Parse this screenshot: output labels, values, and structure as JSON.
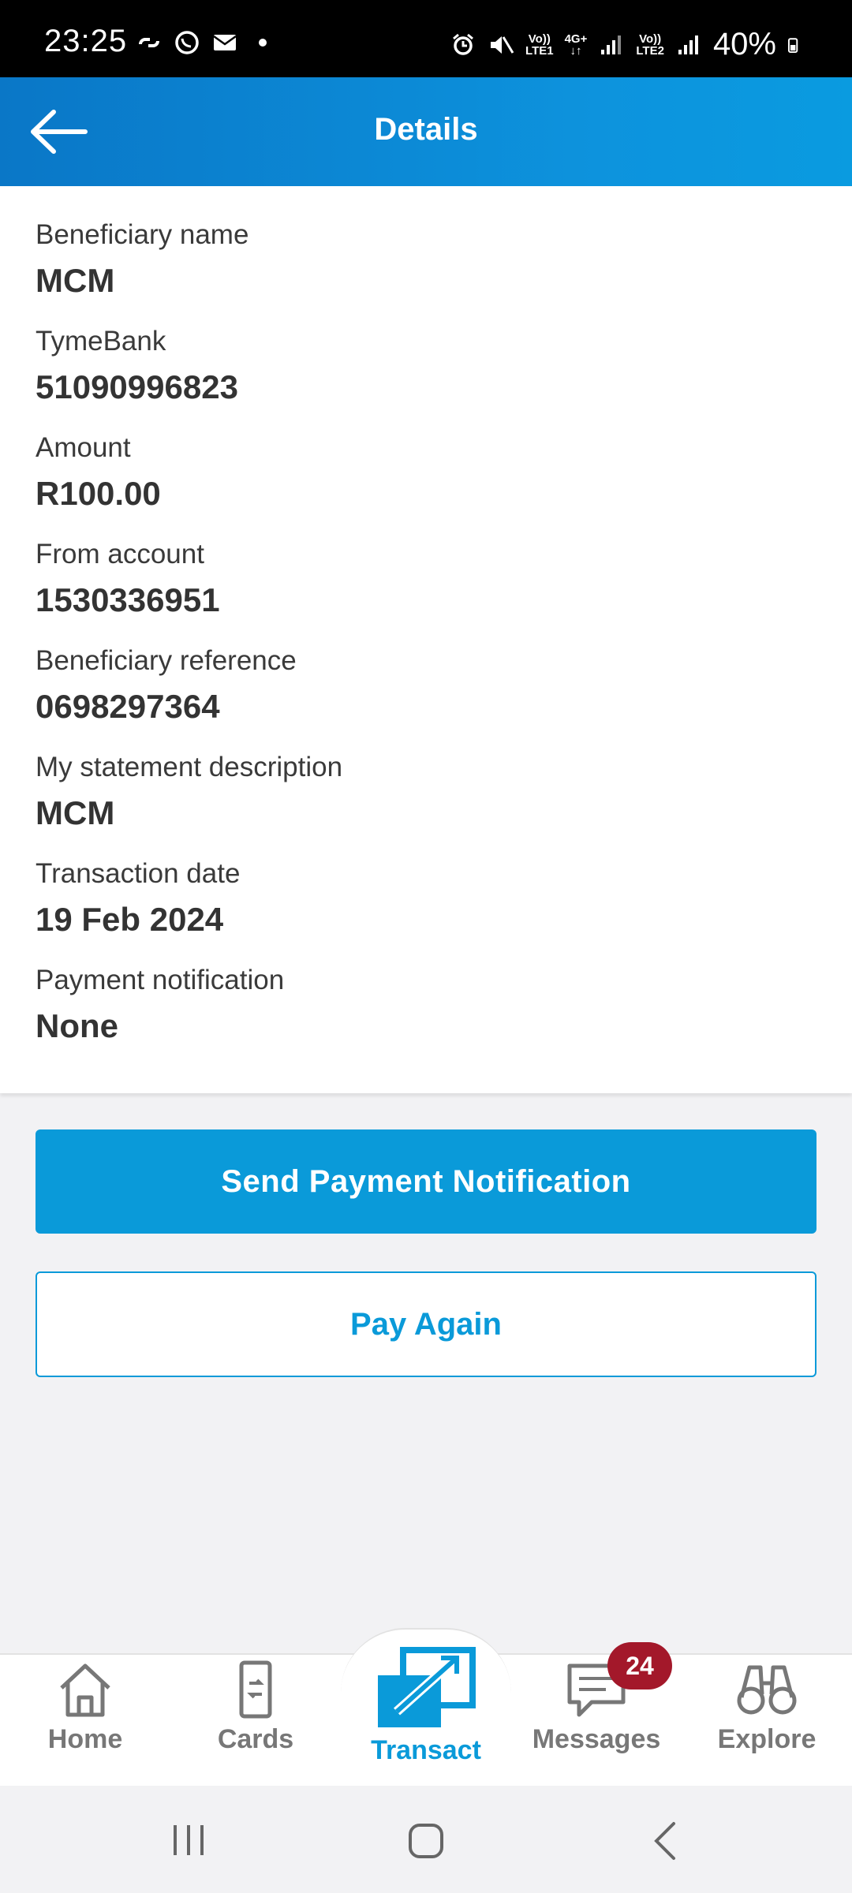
{
  "status_bar": {
    "time": "23:25",
    "battery": "40%",
    "sim1": "LTE1",
    "sim2": "LTE2",
    "network": "4G+"
  },
  "header": {
    "title": "Details"
  },
  "details": [
    {
      "label": "Beneficiary name",
      "value": "MCM"
    },
    {
      "label": "TymeBank",
      "value": "51090996823"
    },
    {
      "label": "Amount",
      "value": "R100.00"
    },
    {
      "label": "From account",
      "value": "1530336951"
    },
    {
      "label": "Beneficiary reference",
      "value": "0698297364"
    },
    {
      "label": "My statement description",
      "value": "MCM"
    },
    {
      "label": "Transaction date",
      "value": "19 Feb 2024"
    },
    {
      "label": "Payment notification",
      "value": "None"
    }
  ],
  "actions": {
    "send_notification": "Send Payment Notification",
    "pay_again": "Pay Again"
  },
  "bottom_nav": {
    "items": [
      {
        "label": "Home",
        "icon": "home-icon"
      },
      {
        "label": "Cards",
        "icon": "cards-icon"
      },
      {
        "label": "Transact",
        "icon": "transact-icon",
        "active": true
      },
      {
        "label": "Messages",
        "icon": "messages-icon",
        "badge": "24"
      },
      {
        "label": "Explore",
        "icon": "binoculars-icon"
      }
    ]
  },
  "colors": {
    "accent": "#0a9ad9",
    "header": "#0a86d0",
    "badge": "#a3182a"
  }
}
